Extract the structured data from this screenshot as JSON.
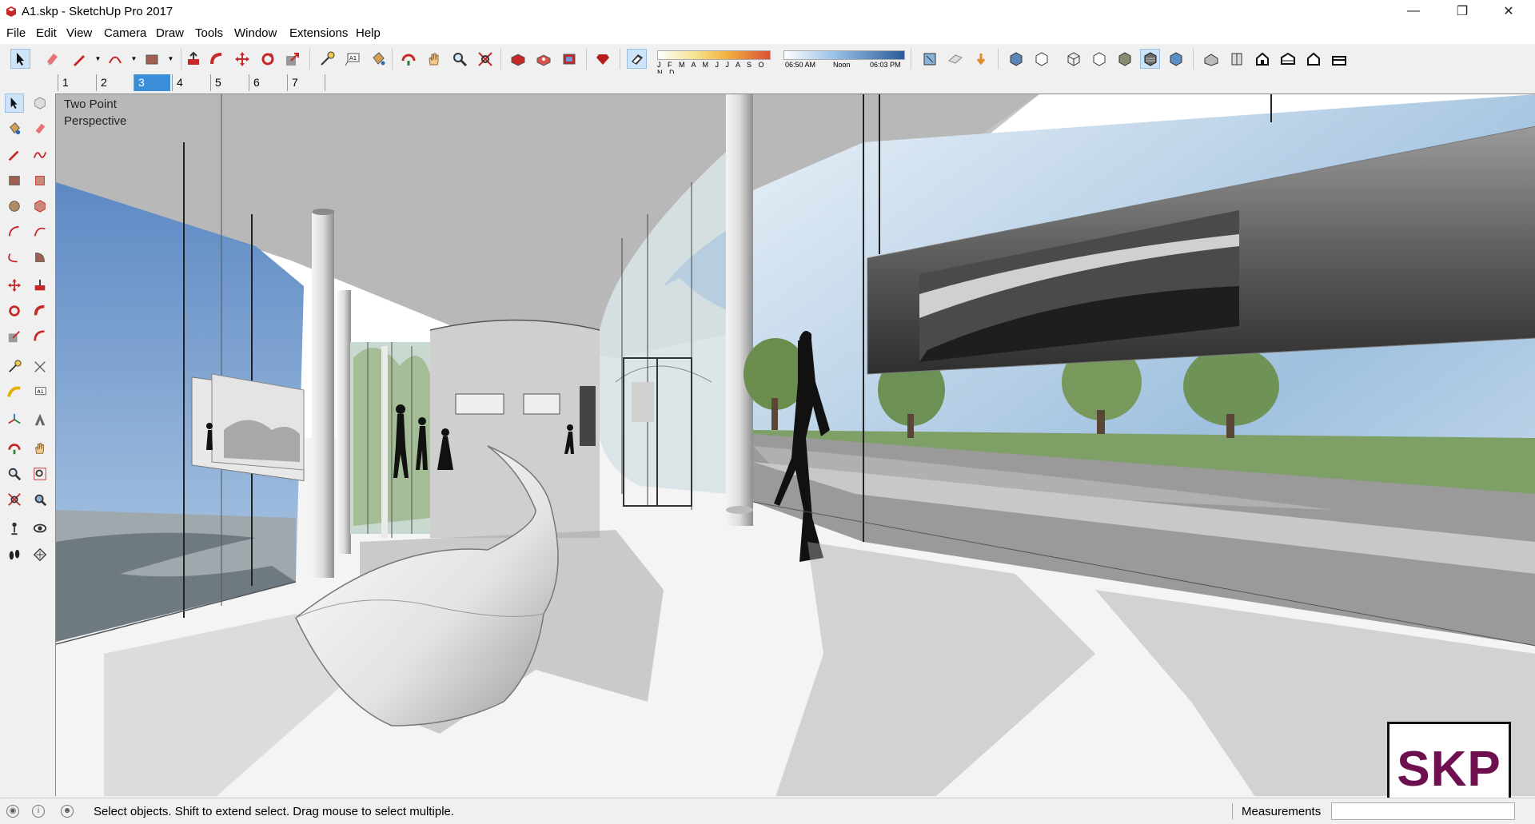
{
  "window": {
    "title": "A1.skp - SketchUp Pro 2017",
    "controls": [
      "minimize-icon",
      "restore-icon",
      "close-icon"
    ]
  },
  "menu": [
    "File",
    "Edit",
    "View",
    "Camera",
    "Draw",
    "Tools",
    "Window",
    "Extensions",
    "Help"
  ],
  "shadow_settings": {
    "months": "J F M A M J J A S O N D",
    "time_start": "06:50 AM",
    "time_mid": "Noon",
    "time_end": "06:03 PM"
  },
  "scenes": {
    "tabs": [
      "1",
      "2",
      "3",
      "4",
      "5",
      "6",
      "7"
    ],
    "active": "3"
  },
  "viewport": {
    "camera_mode": "Two Point Perspective"
  },
  "status": {
    "hint": "Select objects. Shift to extend select. Drag mouse to select multiple.",
    "measurements_label": "Measurements",
    "measurements_value": ""
  },
  "watermark": {
    "logo_text": "SKP"
  },
  "colors": {
    "accent": "#3b8fd9",
    "logo": "#6e1050",
    "sky": "#8fb4d6",
    "grass": "#7e9f66"
  }
}
